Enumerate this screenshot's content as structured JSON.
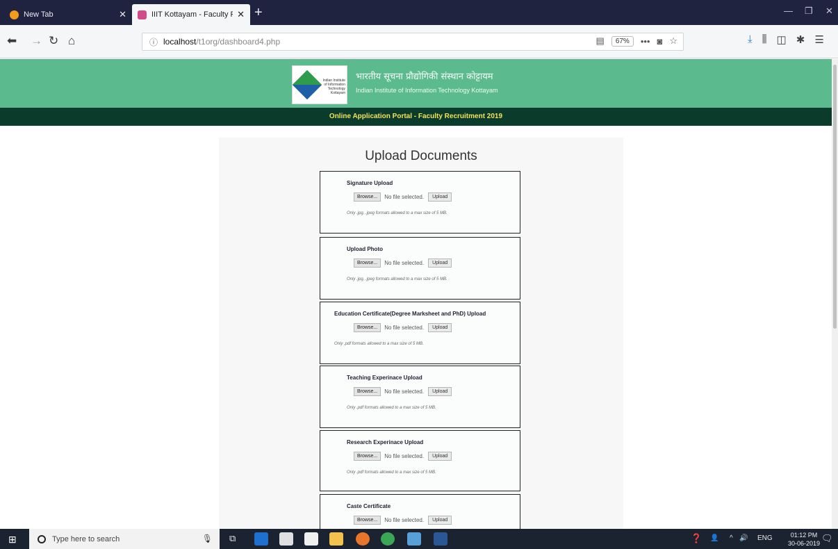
{
  "browser": {
    "tabs": [
      {
        "label": "New Tab"
      },
      {
        "label": "IIIT Kottayam - Faculty Recruitm"
      }
    ],
    "url_host": "localhost",
    "url_path": "/t1org/dashboard4.php",
    "zoom": "67%"
  },
  "header": {
    "hindi_title": "भारतीय सूचना प्रौद्योगिकी संस्थान कोट्टायम",
    "english_title": "Indian Institute of Information Technology Kottayam",
    "logo_text": "Indian Institute of Information Technology Kottayam",
    "portal_banner": "Online Application Portal - Faculty Recruitment 2019"
  },
  "main": {
    "title": "Upload Documents",
    "browse_label": "Browse...",
    "no_file_text": "No file selected.",
    "upload_label": "Upload",
    "documents": [
      {
        "label": "Signature Upload",
        "hint": "Only .jpg, .jpeg formats allowed to a max size of 5 MB."
      },
      {
        "label": "Upload Photo",
        "hint": "Only .jpg, .jpeg formats allowed to a max size of 5 MB."
      },
      {
        "label": "Education Certificate(Degree Marksheet and PhD) Upload",
        "hint": "Only .pdf formats allowed to a max size of 5 MB."
      },
      {
        "label": "Teaching Experinace Upload",
        "hint": "Only .pdf formats allowed to a max size of 5 MB."
      },
      {
        "label": "Research Experinace Upload",
        "hint": "Only .pdf formats allowed to a max size of 5 MB."
      },
      {
        "label": "Caste Certificate",
        "hint": ""
      }
    ]
  },
  "taskbar": {
    "search_placeholder": "Type here to search",
    "language": "ENG",
    "time": "01:12 PM",
    "date": "30-06-2019"
  },
  "colors": {
    "header_green": "#5bbb8e",
    "banner_dark": "#0b3b2a",
    "banner_text": "#f3e35a"
  }
}
